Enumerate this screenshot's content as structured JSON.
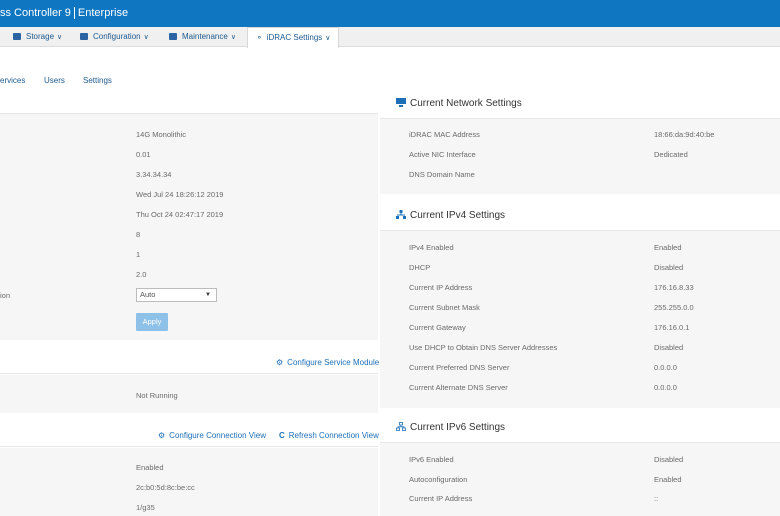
{
  "header": {
    "title_part1": "ss Controller 9",
    "title_part2": "Enterprise"
  },
  "nav": {
    "items": [
      {
        "label": "Storage",
        "icon": "storage-icon"
      },
      {
        "label": "Configuration",
        "icon": "configuration-icon"
      },
      {
        "label": "Maintenance",
        "icon": "maintenance-icon"
      },
      {
        "label": "iDRAC Settings",
        "icon": "idrac-settings-icon",
        "active": true
      }
    ],
    "chevron": "∨"
  },
  "subtabs": [
    "ervices",
    "Users",
    "Settings"
  ],
  "overview": {
    "values": [
      "14G Monolithic",
      "0.01",
      "3.34.34.34",
      "Wed Jul 24 18:26:12 2019",
      "Thu Oct 24 02:47:17 2019",
      "8",
      "1",
      "2.0"
    ],
    "select_label": "ion",
    "select_value": "Auto",
    "apply_label": "Apply"
  },
  "service_module": {
    "configure_label": "Configure Service Module",
    "status": "Not Running"
  },
  "connection_view": {
    "configure_label": "Configure Connection View",
    "refresh_label": "Refresh Connection View",
    "values": [
      "Enabled",
      "2c:b0:5d:8c:be:cc",
      "1/g35"
    ]
  },
  "network": {
    "title": "Current Network Settings",
    "rows": [
      {
        "label": "iDRAC MAC Address",
        "value": "18:66:da:9d:40:be"
      },
      {
        "label": "Active NIC Interface",
        "value": "Dedicated"
      },
      {
        "label": "DNS Domain Name",
        "value": ""
      }
    ]
  },
  "ipv4": {
    "title": "Current IPv4 Settings",
    "rows": [
      {
        "label": "IPv4 Enabled",
        "value": "Enabled"
      },
      {
        "label": "DHCP",
        "value": "Disabled"
      },
      {
        "label": "Current IP Address",
        "value": "176.16.8.33"
      },
      {
        "label": "Current Subnet Mask",
        "value": "255.255.0.0"
      },
      {
        "label": "Current Gateway",
        "value": "176.16.0.1"
      },
      {
        "label": "Use DHCP to Obtain DNS Server Addresses",
        "value": "Disabled"
      },
      {
        "label": "Current Preferred DNS Server",
        "value": "0.0.0.0"
      },
      {
        "label": "Current Alternate DNS Server",
        "value": "0.0.0.0"
      }
    ]
  },
  "ipv6": {
    "title": "Current IPv6 Settings",
    "rows": [
      {
        "label": "IPv6 Enabled",
        "value": "Disabled"
      },
      {
        "label": "Autoconfiguration",
        "value": "Enabled"
      },
      {
        "label": "Current IP Address",
        "value": "::"
      }
    ]
  },
  "colors": {
    "header_blue": "#0f76c2",
    "link_blue": "#1d6fb8",
    "apply_button": "#8ec1e8"
  }
}
